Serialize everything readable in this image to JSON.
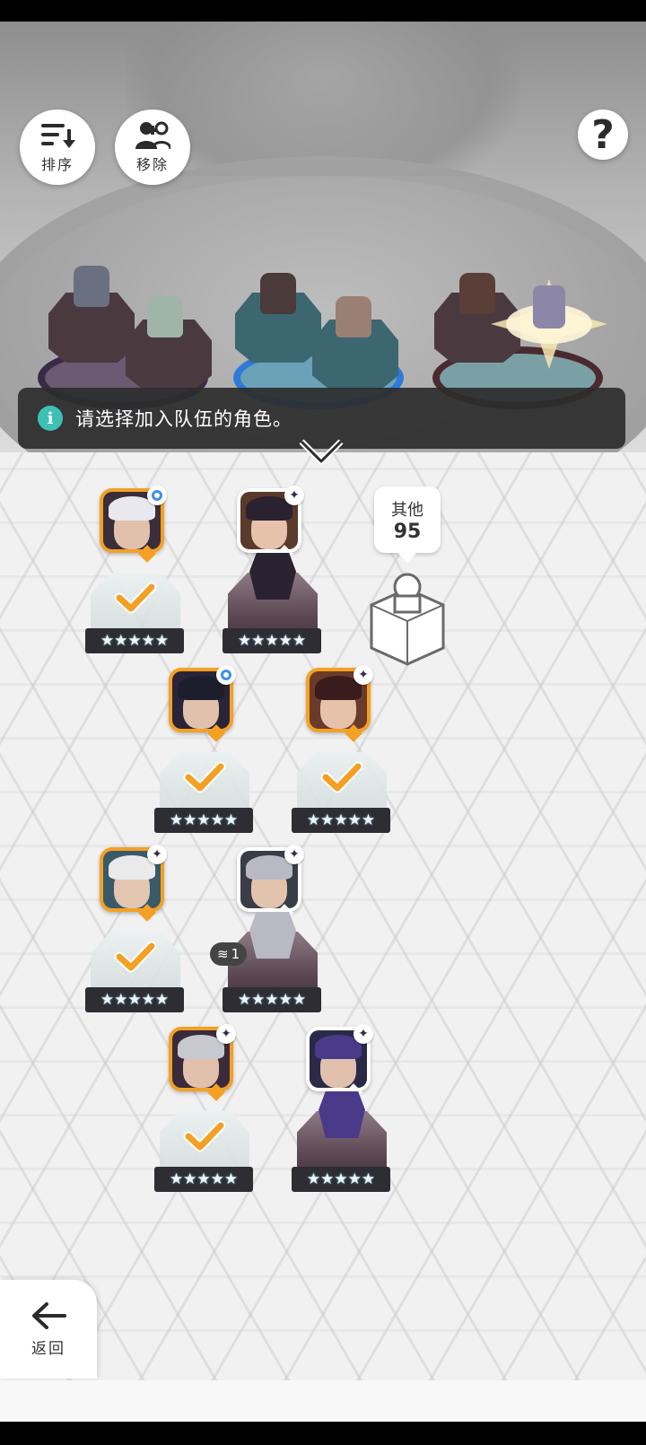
{
  "toolbar": {
    "sort_label": "排序",
    "remove_label": "移除",
    "help_label": "?"
  },
  "banner": {
    "text": "请选择加入队伍的角色。"
  },
  "other": {
    "label": "其他",
    "count": "95"
  },
  "star_text": "★★★★★",
  "roster": [
    {
      "name": "char-1",
      "selected": true,
      "badge": "blue-dot",
      "hair": "#e8e8ee"
    },
    {
      "name": "char-2",
      "selected": false,
      "badge": "spark",
      "hair": "#2a2230"
    },
    {
      "name": "char-3",
      "selected": true,
      "badge": "blue-dot",
      "hair": "#1c1e2e"
    },
    {
      "name": "char-4",
      "selected": true,
      "badge": "spark",
      "hair": "#3a1c1c"
    },
    {
      "name": "char-5",
      "selected": true,
      "badge": "spark",
      "hair": "#eaeaea"
    },
    {
      "name": "char-6",
      "selected": false,
      "badge": "spark",
      "hair": "#b9b9c4",
      "count": "1"
    },
    {
      "name": "char-7",
      "selected": true,
      "badge": "spark",
      "hair": "#c8c8d0"
    },
    {
      "name": "char-8",
      "selected": false,
      "badge": "spark",
      "hair": "#4a3a8a"
    }
  ],
  "back": {
    "label": "返回"
  },
  "colors": {
    "accent_orange": "#f3a024",
    "check_orange": "#f3a024",
    "info_teal": "#3ec1b4",
    "slot_purple": "#3a2a48",
    "slot_blue": "#2f7ad8",
    "slot_red": "#4a2a30"
  },
  "icons": {
    "sort": "sort-desc-icon",
    "remove": "remove-user-icon",
    "help": "question-icon",
    "info": "info-icon",
    "chevron": "chevron-down-icon",
    "back": "arrow-left-icon"
  }
}
